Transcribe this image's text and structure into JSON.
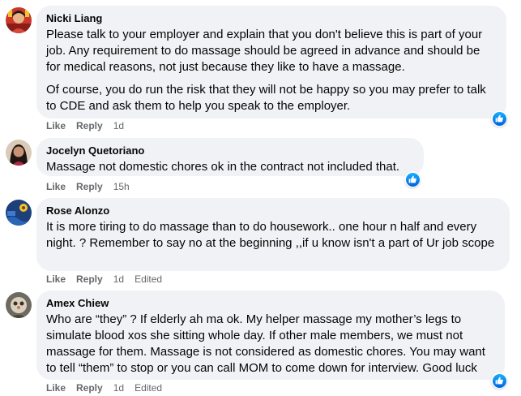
{
  "accent_color": "#1877f2",
  "comments": [
    {
      "author": "Nicki Liang",
      "paragraphs": [
        "Please talk to your employer and explain that you don't believe this is part of your job. Any requirement to do massage should be agreed in advance and should be for medical reasons, not just because they like to have a massage.",
        "Of course, you do run the risk that they will not be happy so you may prefer to talk to CDE and ask them to help you speak to the employer."
      ],
      "like": "Like",
      "reply": "Reply",
      "time": "1d",
      "reaction_icon": "like-icon"
    },
    {
      "author": "Jocelyn Quetoriano",
      "paragraphs": [
        "Massage not domestic chores ok in the contract not included that."
      ],
      "like": "Like",
      "reply": "Reply",
      "time": "15h",
      "reaction_icon": "like-icon"
    },
    {
      "author": "Rose Alonzo",
      "paragraphs": [
        "It is more tiring to do massage than to do housework.. one hour n half and every night. ? Remember to say no at the beginning ,,if u know isn't a part of Ur job scope"
      ],
      "like": "Like",
      "reply": "Reply",
      "time": "1d",
      "edited": "Edited"
    },
    {
      "author": "Amex Chiew",
      "paragraphs": [
        "Who are “they” ? If elderly ah ma ok. My helper massage my mother’s legs to simulate blood xos she sitting whole day. If other male members, we must not massage for them. Massage is not considered as domestic chores. You may want to tell “them” to stop or you can call MOM to come down for interview. Good luck"
      ],
      "like": "Like",
      "reply": "Reply",
      "time": "1d",
      "edited": "Edited",
      "reaction_icon": "like-icon"
    }
  ]
}
